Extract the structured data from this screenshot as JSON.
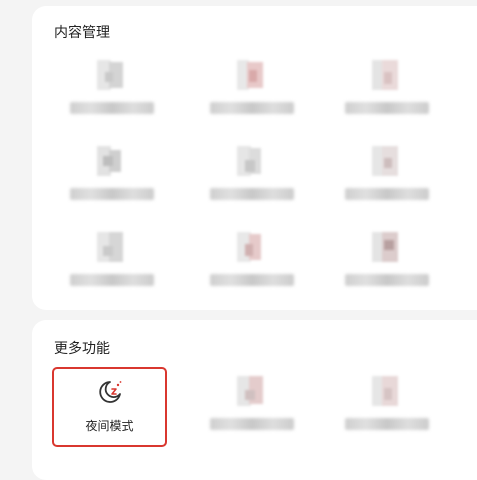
{
  "sections": {
    "content_management": {
      "title": "内容管理"
    },
    "more_functions": {
      "title": "更多功能",
      "night_mode": {
        "label": "夜间模式",
        "icon": "moon-icon",
        "highlight_color": "#d9372f"
      }
    }
  },
  "colors": {
    "page_background": "#f4f4f4",
    "card_background": "#ffffff",
    "title_text": "#222222",
    "accent_red": "#d9372f"
  }
}
